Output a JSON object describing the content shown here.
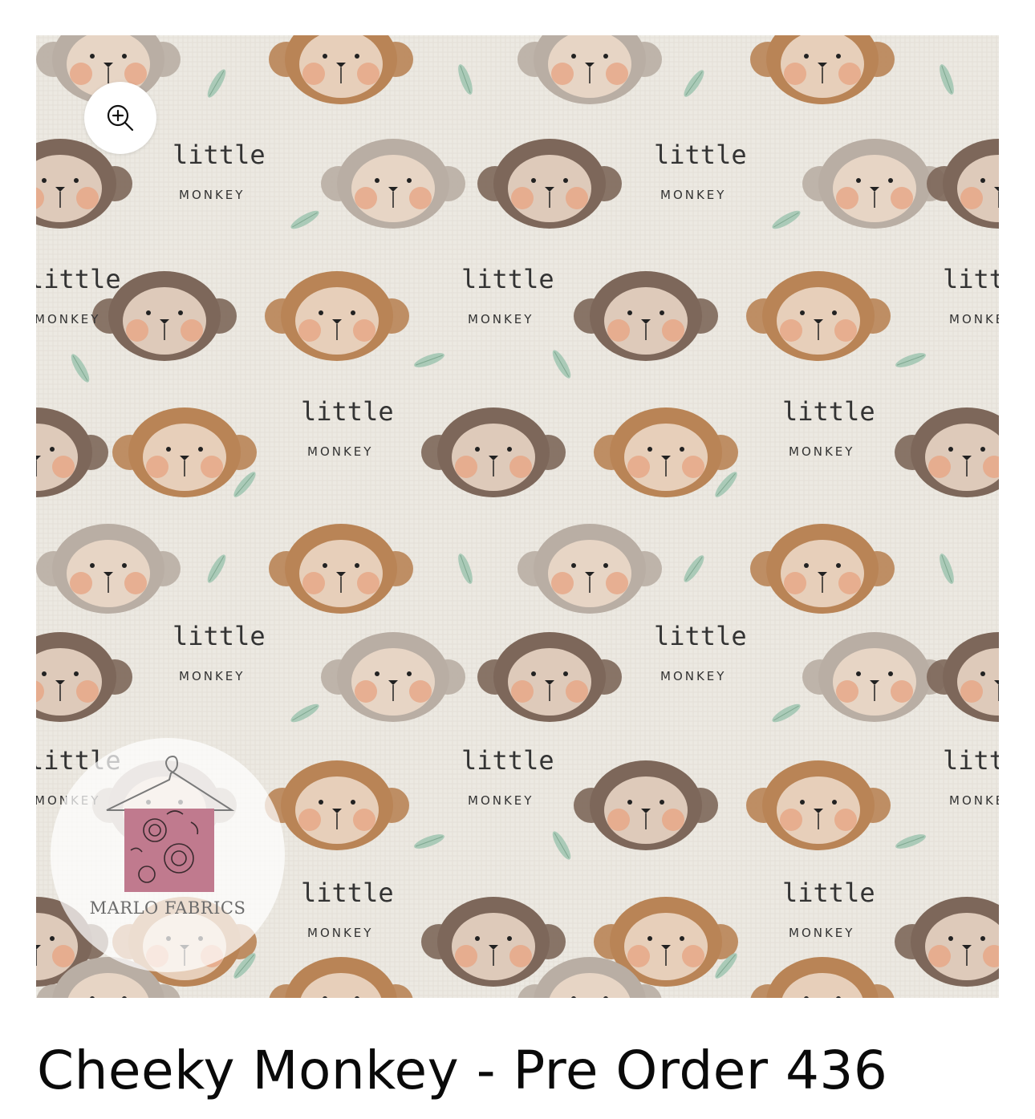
{
  "product": {
    "title": "Cheeky Monkey - Pre Order 436"
  },
  "image": {
    "pattern_line1": "little",
    "pattern_line2": "MONKEY",
    "watermark_text": "MARLO FABRICS",
    "zoom_icon": "zoom-in-icon",
    "colors": {
      "background": "#ece9e2",
      "monkey_light_brown": "#b98456",
      "monkey_dark_brown": "#7d675a",
      "monkey_grey": "#b9aea4",
      "cheek": "#e7a585",
      "leaf": "#9fc4b0"
    }
  }
}
